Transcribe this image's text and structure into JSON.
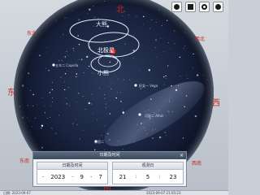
{
  "compass": {
    "north": "北",
    "south": "南",
    "east": "东",
    "west": "西",
    "northeast": "东北",
    "northwest": "西北",
    "southeast": "东南",
    "southwest": "西南"
  },
  "constellations": {
    "big_dipper": "大熊",
    "polaris": "北极星",
    "little_dipper": "小熊"
  },
  "stars": {
    "capella": "五车二 Capella",
    "vega": "织女一 Vega",
    "altair": "河鼓二 Altair",
    "lower_star": "心宿二"
  },
  "panel": {
    "title": "日期及时间",
    "close": "×",
    "date_header": "日期及时间",
    "time_header": "观测日",
    "year": "2023",
    "month": "9",
    "day": "7",
    "hour": "21",
    "minute": "5",
    "second": "23",
    "date_sep": "-",
    "time_sep": ":"
  },
  "statusbar": {
    "left_text": "日期: 2023-09-07",
    "right_text": "2023-09-07 21:05:23"
  },
  "colors": {
    "sky_center": "#25314d",
    "sky_edge": "#0b1022",
    "compass_red": "#c62a1e",
    "polaris_red": "#e0211b",
    "outline_white": "#e6ecf6"
  }
}
